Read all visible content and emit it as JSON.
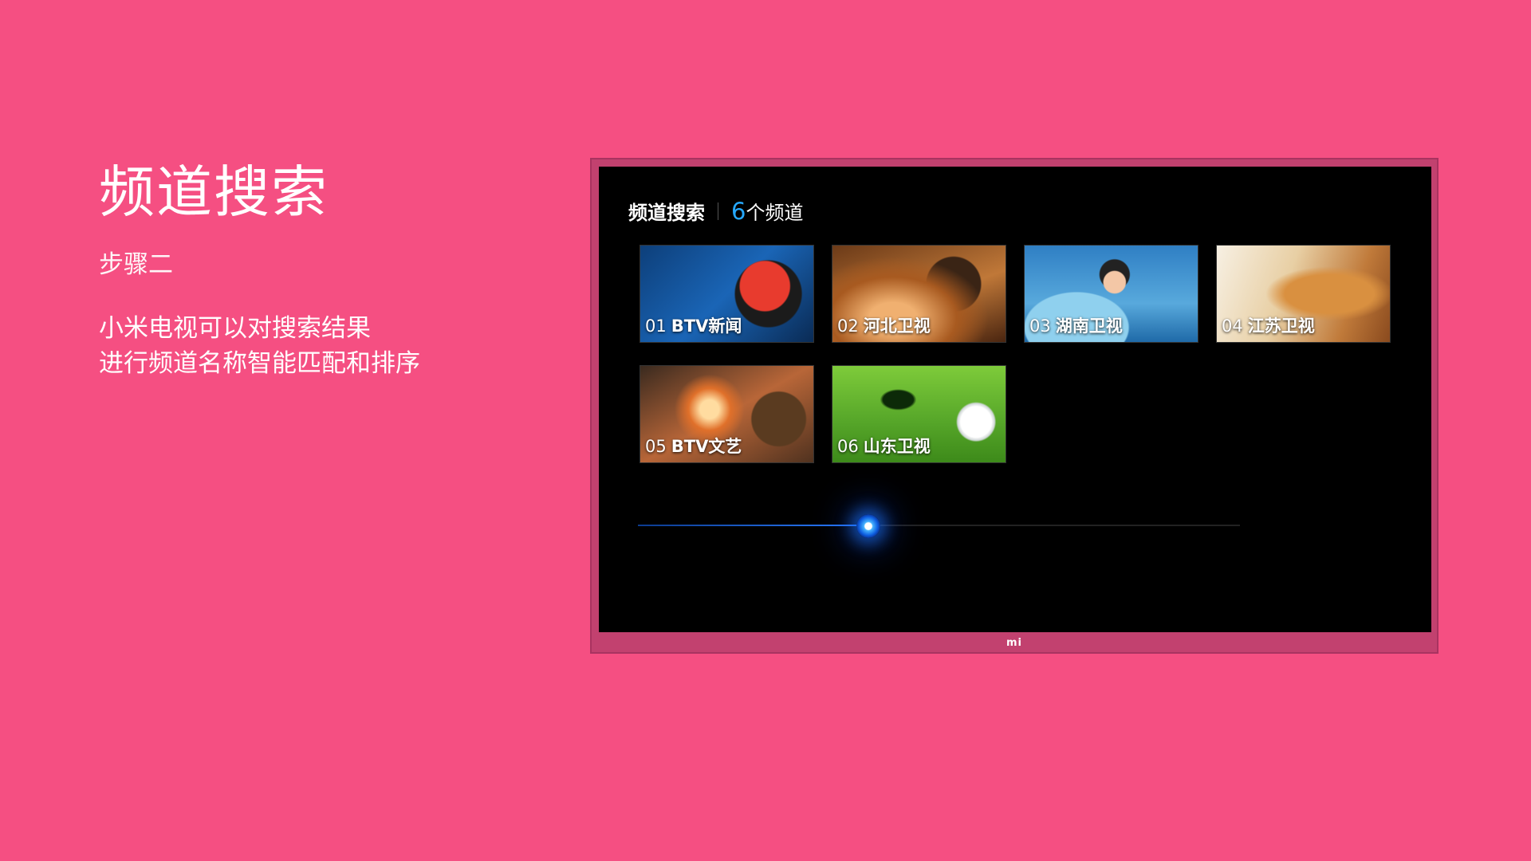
{
  "slide": {
    "headline": "频道搜索",
    "step": "步骤二",
    "desc_line1": "小米电视可以对搜索结果",
    "desc_line2": "进行频道名称智能匹配和排序"
  },
  "tv": {
    "logo": "mi",
    "header": {
      "title": "频道搜索",
      "count_number": "6",
      "count_label": "个频道"
    },
    "channels": [
      {
        "num": "01",
        "name": "BTV新闻",
        "thumb": "motocross-rider"
      },
      {
        "num": "02",
        "name": "河北卫视",
        "thumb": "record-player"
      },
      {
        "num": "03",
        "name": "湖南卫视",
        "thumb": "astro-boy"
      },
      {
        "num": "04",
        "name": "江苏卫视",
        "thumb": "golden-retriever"
      },
      {
        "num": "05",
        "name": "BTV文艺",
        "thumb": "action-explosion"
      },
      {
        "num": "06",
        "name": "山东卫视",
        "thumb": "golf-ball"
      }
    ],
    "voice_progress": 0.382
  },
  "colors": {
    "background": "#f54f82",
    "tv_frame": "#c2416f",
    "accent": "#26a9ff"
  }
}
